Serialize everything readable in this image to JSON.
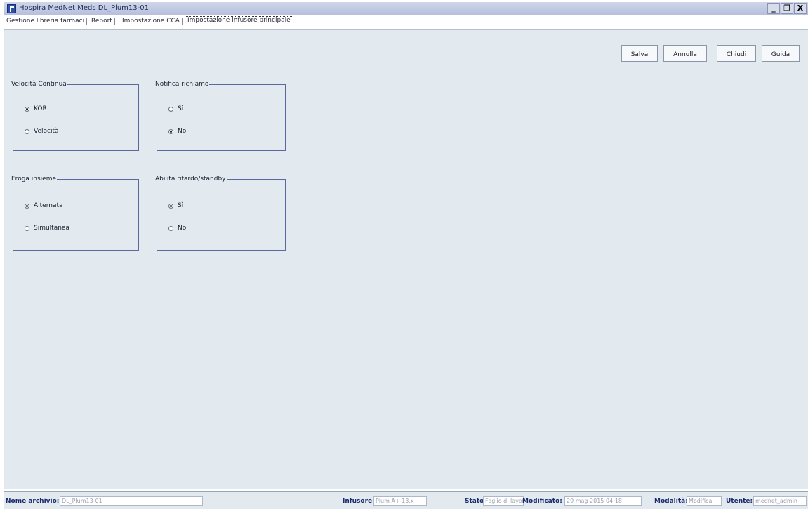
{
  "window": {
    "title": "Hospira MedNet Meds  DL_Plum13-01",
    "minimize": "_",
    "maximize": "❐",
    "close": "X"
  },
  "tabs": [
    {
      "label": "Gestione libreria farmaci"
    },
    {
      "label": "Report"
    },
    {
      "label": "Impostazione CCA"
    },
    {
      "label": "Impostazione infusore principale",
      "active": true
    }
  ],
  "toolbar": {
    "save_label": "Salva",
    "cancel_label": "Annulla",
    "close_label": "Chiudi",
    "help_label": "Guida"
  },
  "groups": {
    "continuous_rate": {
      "legend": "Velocità Continua",
      "options": [
        {
          "label": "KOR",
          "selected": true
        },
        {
          "label": "Velocità",
          "selected": false
        }
      ]
    },
    "callback_notification": {
      "legend": "Notifica richiamo",
      "options": [
        {
          "label": "Sì",
          "selected": false
        },
        {
          "label": "No",
          "selected": true
        }
      ]
    },
    "delivery_together": {
      "legend": "Eroga insieme",
      "options": [
        {
          "label": "Alternata",
          "selected": true
        },
        {
          "label": "Simultanea",
          "selected": false
        }
      ]
    },
    "delay_standby": {
      "legend": "Abilita ritardo/standby",
      "options": [
        {
          "label": "Sì",
          "selected": true
        },
        {
          "label": "No",
          "selected": false
        }
      ]
    }
  },
  "status": {
    "archive_label": "Nome archivio:",
    "archive_value": "DL_Plum13-01",
    "infuser_label": "Infusore:",
    "infuser_value": "Plum A+ 13.x",
    "state_label": "Stato:",
    "state_value": "Foglio di lavoro",
    "modified_label": "Modificato:",
    "modified_value": "29 mag 2015 04:18",
    "mode_label": "Modalità:",
    "mode_value": "Modifica",
    "user_label": "Utente:",
    "user_value": "mednet_admin"
  },
  "colors": {
    "panel_bg": "#e2eaf0",
    "group_border": "#5a6aa0",
    "titlebar": "#b6c0dc"
  }
}
